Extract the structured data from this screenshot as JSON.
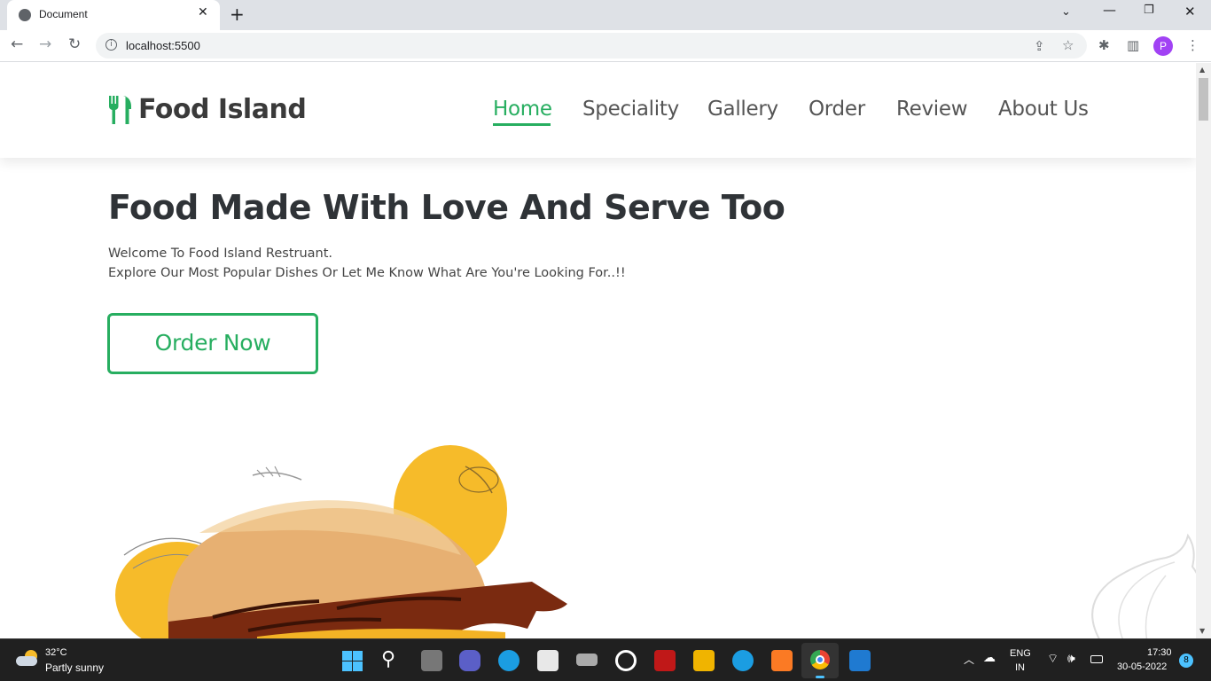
{
  "browser": {
    "tab_title": "Document",
    "url": "localhost:5500",
    "profile_initial": "P"
  },
  "site": {
    "brand": "Food Island",
    "nav": [
      {
        "label": "Home",
        "active": true
      },
      {
        "label": "Speciality",
        "active": false
      },
      {
        "label": "Gallery",
        "active": false
      },
      {
        "label": "Order",
        "active": false
      },
      {
        "label": "Review",
        "active": false
      },
      {
        "label": "About Us",
        "active": false
      }
    ],
    "accent_color": "#27ae60"
  },
  "hero": {
    "title": "Food Made With Love And Serve Too",
    "line1": "Welcome To Food Island Restruant.",
    "line2": "Explore Our Most Popular Dishes Or Let Me Know What Are You're Looking For..!!",
    "cta": "Order Now"
  },
  "taskbar": {
    "weather_temp": "32°C",
    "weather_desc": "Partly sunny",
    "lang_top": "ENG",
    "lang_bottom": "IN",
    "time": "17:30",
    "date": "30-05-2022",
    "notification_count": "8"
  }
}
